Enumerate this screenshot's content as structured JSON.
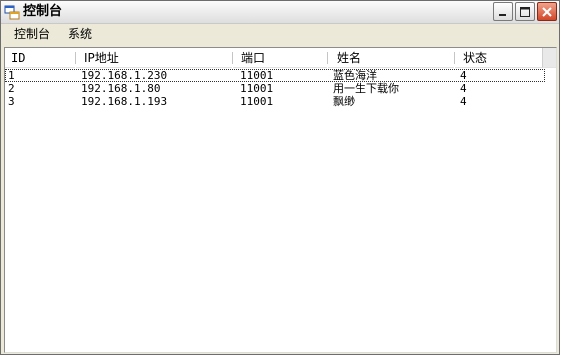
{
  "window": {
    "title": "控制台",
    "icon": "app-window-icon",
    "caption_buttons": [
      "minimize-icon",
      "maximize-icon",
      "close-icon"
    ]
  },
  "menu": {
    "items": [
      {
        "label": "控制台"
      },
      {
        "label": "系统"
      }
    ]
  },
  "list": {
    "columns": [
      {
        "label": "ID"
      },
      {
        "label": "IP地址"
      },
      {
        "label": "端口"
      },
      {
        "label": "姓名"
      },
      {
        "label": "状态"
      }
    ],
    "rows": [
      {
        "id": "1",
        "ip": "192.168.1.230",
        "port": "11001",
        "name": "蓝色海洋",
        "status": "4"
      },
      {
        "id": "2",
        "ip": "192.168.1.80",
        "port": "11001",
        "name": "用一生下载你",
        "status": "4"
      },
      {
        "id": "3",
        "ip": "192.168.1.193",
        "port": "11001",
        "name": "飘缈",
        "status": "4"
      }
    ]
  },
  "colors": {
    "window_bg": "#ece9d8",
    "close_button": "#d2472a"
  }
}
